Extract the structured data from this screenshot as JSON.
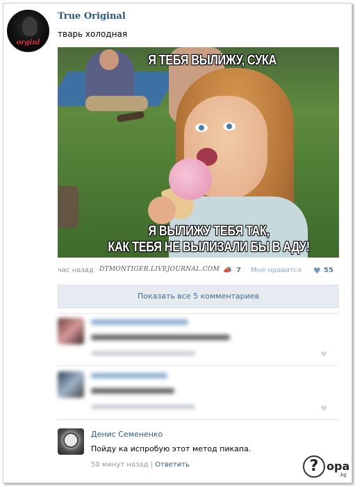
{
  "post": {
    "author": "True Original",
    "text": "тварь холодная",
    "avatar_logo": "orginl",
    "meme": {
      "caption_top": "Я ТЕБЯ ВЫЛИЖУ, СУКА",
      "caption_bottom_1": "Я ВЫЛИЖУ ТЕБЯ ТАК,",
      "caption_bottom_2": "КАК ТЕБЯ НЕ ВЫЛИЗАЛИ БЫ В АДУ!"
    },
    "time": "час назад",
    "watermark_site": "DTMONTIGER.LIVEJOURNAL.COM",
    "share_count": "7",
    "like_label": "Мне нравится",
    "like_count": "55",
    "share_icon": "megaphone-icon",
    "heart_icon": "heart-icon"
  },
  "show_comments_label": "Показать все 5 комментариев",
  "comments": [
    {
      "author": "Денис Семененко",
      "text": "Пойду ка испробую этот метод пикапа.",
      "time": "50 минут назад",
      "sep": "|",
      "reply_label": "Ответить"
    }
  ],
  "watermark": {
    "symbol": "?",
    "text": "opa",
    "suffix": ".kg"
  },
  "colors": {
    "link": "#2b587a",
    "button_bg": "#e6ebf1",
    "button_text": "#45688e"
  }
}
